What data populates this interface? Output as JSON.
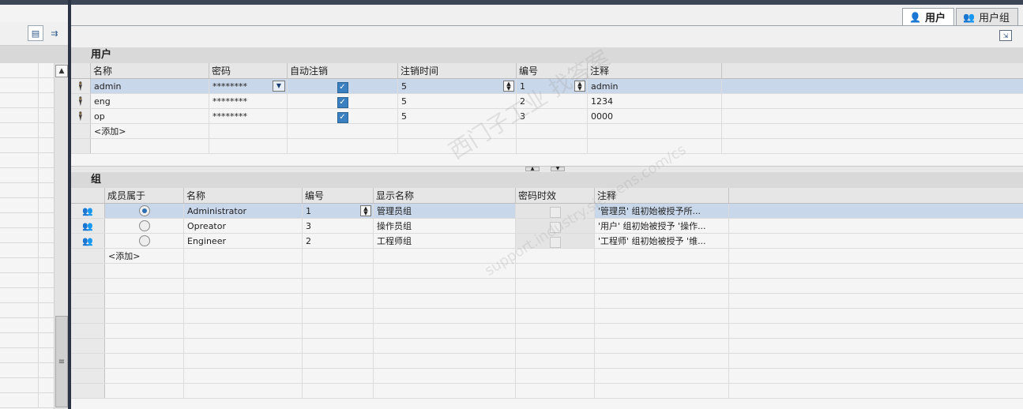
{
  "tabs": [
    {
      "label": "用户",
      "icon": "user-icon",
      "active": true
    },
    {
      "label": "用户组",
      "icon": "group-icon",
      "active": false
    }
  ],
  "users": {
    "title": "用户",
    "columns": [
      "名称",
      "密码",
      "自动注销",
      "注销时间",
      "编号",
      "注释"
    ],
    "rows": [
      {
        "name": "admin",
        "password": "********",
        "auto_logoff": true,
        "logoff_time": "5",
        "number": "1",
        "comment": "admin"
      },
      {
        "name": "eng",
        "password": "********",
        "auto_logoff": true,
        "logoff_time": "5",
        "number": "2",
        "comment": "1234"
      },
      {
        "name": "op",
        "password": "********",
        "auto_logoff": true,
        "logoff_time": "5",
        "number": "3",
        "comment": "0000"
      }
    ],
    "add_label": "<添加>"
  },
  "groups": {
    "title": "组",
    "columns": [
      "成员属于",
      "名称",
      "编号",
      "显示名称",
      "密码时效",
      "注释"
    ],
    "rows": [
      {
        "member": true,
        "name": "Administrator",
        "number": "1",
        "display_name": "管理员组",
        "pw_aging": false,
        "comment": "'管理员' 组初始被授予所..."
      },
      {
        "member": false,
        "name": "Opreator",
        "number": "3",
        "display_name": "操作员组",
        "pw_aging": false,
        "comment": "'用户' 组初始被授予 '操作..."
      },
      {
        "member": false,
        "name": "Engineer",
        "number": "2",
        "display_name": "工程师组",
        "pw_aging": false,
        "comment": "'工程师' 组初始被授予 '维..."
      }
    ],
    "add_label": "<添加>"
  },
  "watermark": {
    "line1": "西门子工业  找答案",
    "line2": "support.industry.siemens.com/cs"
  },
  "colors": {
    "topbar": "#3c4657",
    "selection": "#c9d7ea",
    "checkbox": "#3a7fc0"
  }
}
